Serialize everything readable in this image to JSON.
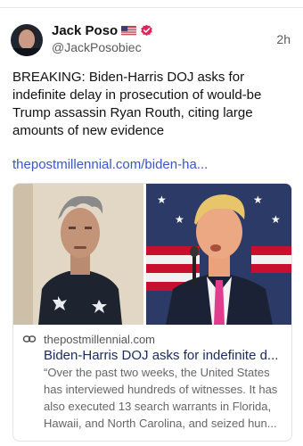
{
  "post": {
    "author_name": "Jack Poso",
    "flag_emoji": "us-flag-icon",
    "verified_icon": "verified-badge-icon",
    "handle": "@JackPosobiec",
    "time": "2h",
    "text": "BREAKING: Biden-Harris DOJ asks for indefinite delay in prosecution of would-be Trump assassin Ryan Routh, citing large amounts of new evidence",
    "link": "thepostmillennial.com/biden-ha..."
  },
  "card": {
    "domain": "thepostmillennial.com",
    "title": "Biden-Harris DOJ asks for indefinite d...",
    "description": "“Over the past two weeks, the United States has interviewed hundreds of witnesses. It has also executed 13 search warrants in Florida, Hawaii, and North Carolina, and seized hun...",
    "link_icon": "link-chain-icon"
  },
  "colors": {
    "link": "#3b56c6",
    "verified": "#e0245e",
    "muted": "#5b5b5b"
  }
}
